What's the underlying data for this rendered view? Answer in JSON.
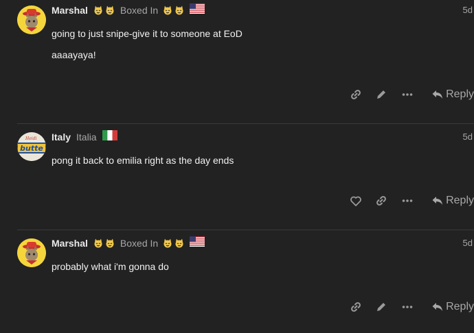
{
  "posts": [
    {
      "username": "Marshal",
      "title": "Boxed In",
      "date": "5d",
      "paragraphs": [
        "going to just snipe-give it to someone at EoD",
        "aaaayaya!"
      ],
      "actions": [
        "link-icon",
        "edit-icon",
        "more-icon"
      ],
      "reply_label": "Reply"
    },
    {
      "username": "Italy",
      "fullname": "Italia",
      "date": "5d",
      "paragraphs": [
        "pong it back to emilia right as the day ends"
      ],
      "actions": [
        "heart-icon",
        "link-icon",
        "more-icon"
      ],
      "reply_label": "Reply"
    },
    {
      "username": "Marshal",
      "title": "Boxed In",
      "date": "5d",
      "paragraphs": [
        "probably what i'm gonna do"
      ],
      "actions": [
        "link-icon",
        "edit-icon",
        "more-icon"
      ],
      "reply_label": "Reply"
    }
  ]
}
